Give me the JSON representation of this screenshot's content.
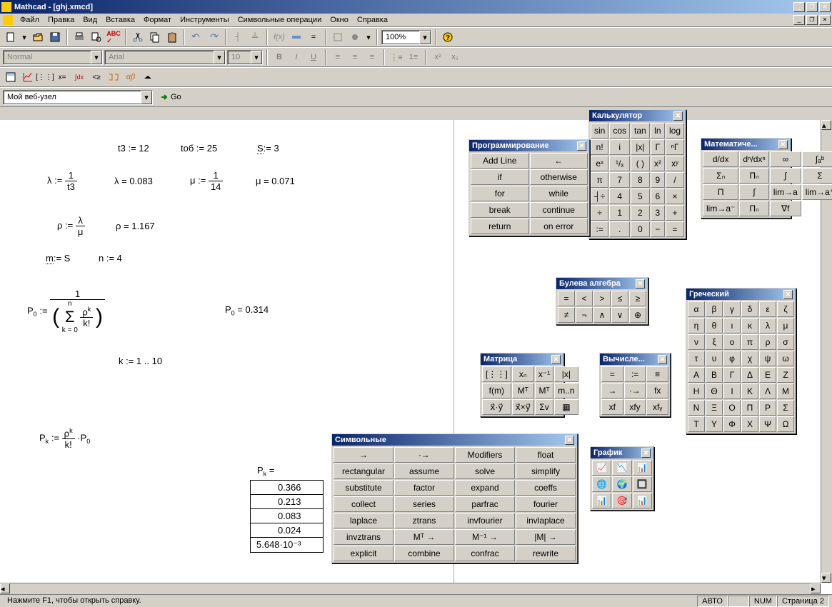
{
  "titlebar": "Mathcad - [ghj.xmcd]",
  "menubar": [
    "Файл",
    "Правка",
    "Вид",
    "Вставка",
    "Формат",
    "Инструменты",
    "Символьные операции",
    "Окно",
    "Справка"
  ],
  "format_toolbar": {
    "style": "Normal",
    "font": "Arial",
    "size": "10",
    "zoom": "100%"
  },
  "web_toolbar": {
    "site": "Мой веб-узел",
    "go": "Go"
  },
  "statusbar": {
    "help": "Нажмите F1, чтобы открыть справку.",
    "auto": "АВТО",
    "num": "NUM",
    "page": "Страница 2"
  },
  "worksheet": {
    "t3": "t3 := 12",
    "tob": "tоб := 25",
    "S": "S",
    "Sval": ":= 3",
    "lambda_def_l": "λ :=",
    "lambda_def_num": "1",
    "lambda_def_den": "t3",
    "lambda_val": "λ = 0.083",
    "mu_def_l": "μ :=",
    "mu_def_num": "1",
    "mu_def_den": "14",
    "mu_val": "μ = 0.071",
    "rho_def_l": "ρ :=",
    "rho_def_num": "λ",
    "rho_def_den": "μ",
    "rho_val": "ρ = 1.167",
    "m_def": "m",
    "m_val": ":= S",
    "n_def": "n := 4",
    "p0_l": "P",
    "p0_sub": "0",
    "p0_assign": " := ",
    "p0_num": "1",
    "p0_sum_top": "n",
    "p0_sum_bot": "k = 0",
    "p0_rho": "ρ",
    "p0_k": "k",
    "p0_kfact": "k!",
    "p0_val_l": "P",
    "p0_val_sub": "0",
    "p0_val_eq": " = 0.314",
    "k_range": "k := 1 .. 10",
    "pk_l": "P",
    "pk_sub": "k",
    "pk_assign": " := ",
    "pk_rho": "ρ",
    "pk_k": "k",
    "pk_kfact": "k!",
    "pk_p0": "·P",
    "pk_p0sub": "0",
    "pk_header": "P",
    "pk_header_sub": "k",
    "pk_header_eq": " =",
    "pk_values": [
      "0.366",
      "0.213",
      "0.083",
      "0.024",
      "5.648·10⁻³"
    ]
  },
  "palettes": {
    "calc": {
      "title": "Калькулятор",
      "items": [
        "sin",
        "cos",
        "tan",
        "ln",
        "log",
        "n!",
        "i",
        "|x|",
        "Γ",
        "ⁿΓ",
        "eˣ",
        "¹/ₓ",
        "( )",
        "x²",
        "xʸ",
        "π",
        "7",
        "8",
        "9",
        "/",
        "┤÷",
        "4",
        "5",
        "6",
        "×",
        "÷",
        "1",
        "2",
        "3",
        "+",
        ":=",
        ".",
        "0",
        "−",
        "="
      ]
    },
    "prog": {
      "title": "Программирование",
      "items": [
        "Add Line",
        "←",
        "if",
        "otherwise",
        "for",
        "while",
        "break",
        "continue",
        "return",
        "on error"
      ]
    },
    "math": {
      "title": "Математиче...",
      "items": [
        "d/dx",
        "dⁿ/dxⁿ",
        "∞",
        "∫ₐᵇ",
        "Σₙ",
        "Πₙ",
        "∫",
        "Σ",
        "Π",
        "∫",
        "lim→a",
        "lim→a⁺",
        "lim→a⁻",
        "Πₙ",
        "∇f"
      ]
    },
    "bool": {
      "title": "Булева алгебра",
      "items": [
        "=",
        "<",
        ">",
        "≤",
        "≥",
        "≠",
        "¬",
        "∧",
        "∨",
        "⊕"
      ]
    },
    "greek": {
      "title": "Греческий",
      "items": [
        "α",
        "β",
        "γ",
        "δ",
        "ε",
        "ζ",
        "η",
        "θ",
        "ι",
        "κ",
        "λ",
        "μ",
        "ν",
        "ξ",
        "ο",
        "π",
        "ρ",
        "σ",
        "τ",
        "υ",
        "φ",
        "χ",
        "ψ",
        "ω",
        "Α",
        "Β",
        "Γ",
        "Δ",
        "Ε",
        "Ζ",
        "Η",
        "Θ",
        "Ι",
        "Κ",
        "Λ",
        "Μ",
        "Ν",
        "Ξ",
        "Ο",
        "Π",
        "Ρ",
        "Σ",
        "Τ",
        "Υ",
        "Φ",
        "Χ",
        "Ψ",
        "Ω"
      ]
    },
    "matrix": {
      "title": "Матрица",
      "items": [
        "[⋮⋮]",
        "xₙ",
        "x⁻¹",
        "|x|",
        "f(m)",
        "Mᵀ",
        "Mᵀ",
        "m..n",
        "x⃗·y⃗",
        "x⃗×y⃗",
        "Σv",
        "▦"
      ]
    },
    "eval": {
      "title": "Вычисле...",
      "items": [
        "=",
        ":=",
        "≡",
        "→",
        "∙→",
        "fx",
        "xf",
        "xfy",
        "xfᵧ"
      ]
    },
    "graph": {
      "title": "График",
      "items": [
        "📈",
        "📉",
        "📊",
        "🌐",
        "🌍",
        "🔲",
        "📊",
        "🎯",
        "📊"
      ]
    },
    "symbolic": {
      "title": "Символьные",
      "items": [
        "→",
        "∙→",
        "Modifiers",
        "float",
        "rectangular",
        "assume",
        "solve",
        "simplify",
        "substitute",
        "factor",
        "expand",
        "coeffs",
        "collect",
        "series",
        "parfrac",
        "fourier",
        "laplace",
        "ztrans",
        "invfourier",
        "invlaplace",
        "invztrans",
        "Mᵀ →",
        "M⁻¹ →",
        "|M| →",
        "explicit",
        "combine",
        "confrac",
        "rewrite"
      ]
    }
  }
}
